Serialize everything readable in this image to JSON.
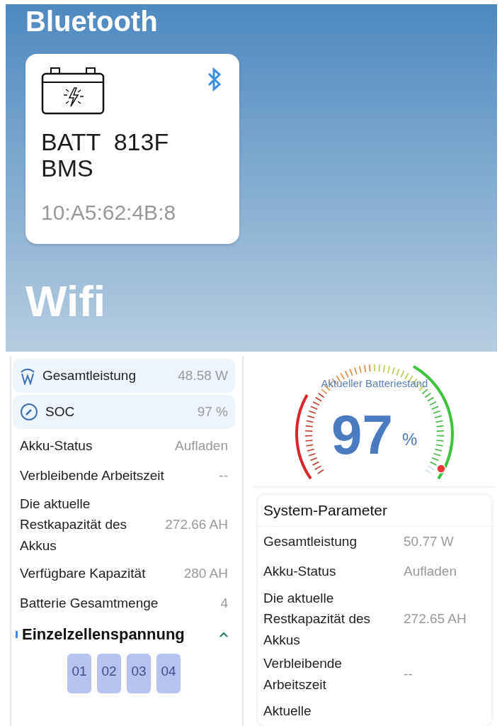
{
  "bluetooth_section": {
    "title": "Bluetooth",
    "device_card": {
      "name_line_1": "BATT  813F",
      "name_line_2": "BMS",
      "address": "10:A5:62:4B:8"
    }
  },
  "wifi_section": {
    "title": "Wifi"
  },
  "overview_panel": {
    "highlighted_rows": [
      {
        "kind": "power",
        "label": "Gesamtleistung",
        "value": "48.58 W"
      },
      {
        "kind": "soc",
        "label": "SOC",
        "value": "97 %"
      }
    ],
    "rows": [
      {
        "label": "Akku-Status",
        "value": "Aufladen"
      },
      {
        "label": "Verbleibende Arbeitszeit",
        "value": "--"
      },
      {
        "label": "Die aktuelle Restkapazität des Akkus",
        "value": "272.66 AH"
      },
      {
        "label": "Verfügbare Kapazität",
        "value": "280 AH"
      },
      {
        "label": "Batterie Gesamtmenge",
        "value": "4"
      }
    ],
    "cell_section": {
      "title": "Einzelzellenspannung",
      "expanded": true,
      "cells": [
        "01",
        "02",
        "03",
        "04"
      ]
    }
  },
  "gauge": {
    "caption": "Aktueller Batteriestand",
    "value": "97",
    "unit": "%"
  },
  "system_parameters": {
    "title": "System-Parameter",
    "rows": [
      {
        "label": "Gesamtleistung",
        "value": "50.77 W"
      },
      {
        "label": "Akku-Status",
        "value": "Aufladen"
      },
      {
        "label": "Die aktuelle Restkapazität des Akkus",
        "value": "272.65 AH"
      },
      {
        "label": "Verbleibende Arbeitszeit",
        "value": "--"
      },
      {
        "label": "Aktuelle"
      }
    ]
  }
}
